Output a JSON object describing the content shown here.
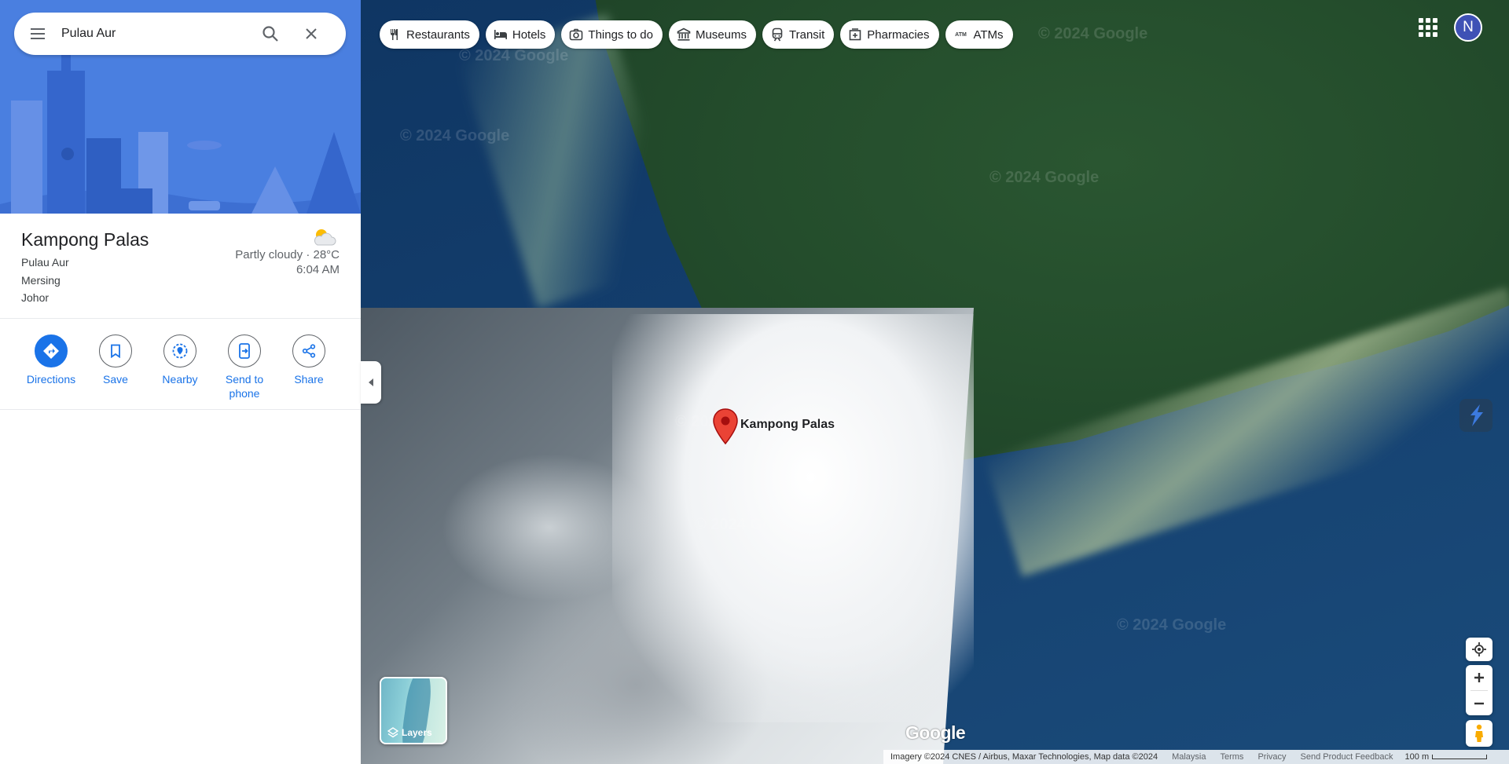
{
  "search": {
    "query": "Pulau Aur"
  },
  "chips": [
    {
      "label": "Restaurants",
      "icon": "fork-knife-icon"
    },
    {
      "label": "Hotels",
      "icon": "bed-icon"
    },
    {
      "label": "Things to do",
      "icon": "camera-icon"
    },
    {
      "label": "Museums",
      "icon": "museum-icon"
    },
    {
      "label": "Transit",
      "icon": "train-icon"
    },
    {
      "label": "Pharmacies",
      "icon": "pharmacy-icon"
    },
    {
      "label": "ATMs",
      "icon": "atm-icon"
    }
  ],
  "account": {
    "initial": "N",
    "color": "#3f51b5"
  },
  "place": {
    "name": "Kampong Palas",
    "address_lines": [
      "Pulau Aur",
      "Mersing",
      "Johor"
    ],
    "weather": "Partly cloudy · 28°C",
    "time": "6:04 AM"
  },
  "actions": [
    {
      "label": "Directions",
      "icon": "directions-icon",
      "primary": true
    },
    {
      "label": "Save",
      "icon": "bookmark-icon",
      "primary": false
    },
    {
      "label": "Nearby",
      "icon": "nearby-icon",
      "primary": false
    },
    {
      "label": "Send to phone",
      "icon": "send-to-phone-icon",
      "primary": false
    },
    {
      "label": "Share",
      "icon": "share-icon",
      "primary": false
    }
  ],
  "map": {
    "marker_label": "Kampong Palas",
    "watermarks": [
      "© 2024 Google"
    ],
    "layers_label": "Layers",
    "logo": "Google"
  },
  "footer": {
    "imagery": "Imagery ©2024 CNES / Airbus, Maxar Technologies, Map data ©2024",
    "country": "Malaysia",
    "terms": "Terms",
    "privacy": "Privacy",
    "feedback": "Send Product Feedback",
    "scale": "100 m"
  },
  "colors": {
    "accent": "#1a73e8",
    "marker": "#ea4335",
    "hero": "#4a7fe0"
  }
}
